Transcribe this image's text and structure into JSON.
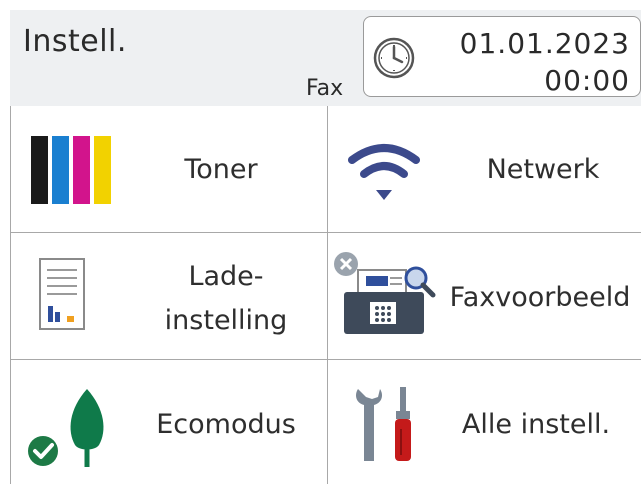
{
  "header": {
    "title": "Instell.",
    "mode": "Fax",
    "date": "01.01.2023",
    "time": "00:00"
  },
  "tiles": [
    {
      "label": "Toner",
      "icon": "toner-icon"
    },
    {
      "label": "Netwerk",
      "icon": "wifi-icon"
    },
    {
      "label_line1": "Lade-",
      "label_line2": "instelling",
      "icon": "tray-setting-icon"
    },
    {
      "label": "Faxvoorbeeld",
      "icon": "fax-preview-icon"
    },
    {
      "label": "Ecomodus",
      "icon": "eco-leaf-icon"
    },
    {
      "label": "Alle instell.",
      "icon": "tools-icon"
    }
  ],
  "colors": {
    "toner_black": "#1a1a1a",
    "toner_cyan": "#1a7fd0",
    "toner_magenta": "#d2148c",
    "toner_yellow": "#f2d200",
    "wifi": "#3c4a8c",
    "eco_green": "#0f7a4a",
    "tool_red": "#c41a1a",
    "header_bg": "#eef0f2"
  }
}
